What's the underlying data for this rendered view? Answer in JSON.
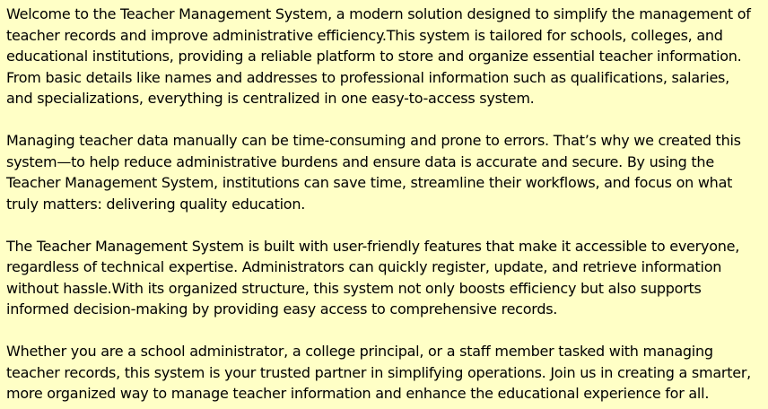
{
  "colors": {
    "background": "#ffffc6",
    "text": "#000000"
  },
  "about": {
    "paragraphs": [
      "Welcome to the Teacher Management System, a modern solution designed to simplify the management of teacher records and improve administrative efficiency.This system is tailored for schools, colleges, and educational institutions, providing a reliable platform to store and organize essential teacher information. From basic details like names and addresses to professional information such as qualifications, salaries, and specializations, everything is centralized in one easy-to-access system.",
      "Managing teacher data manually can be time-consuming and prone to errors. That’s why we created this system—to help reduce administrative burdens and ensure data is accurate and secure. By using the Teacher Management System, institutions can save time, streamline their workflows, and focus on what truly matters: delivering quality education.",
      "The Teacher Management System is built with user-friendly features that make it accessible to everyone, regardless of technical expertise. Administrators can quickly register, update, and retrieve information without hassle.With its organized structure, this system not only boosts efficiency but also supports informed decision-making by providing easy access to comprehensive records.",
      "Whether you are a school administrator, a college principal, or a staff member tasked with managing teacher records, this system is your trusted partner in simplifying operations. Join us in creating a smarter, more organized way to manage teacher information and enhance the educational experience for all."
    ]
  }
}
